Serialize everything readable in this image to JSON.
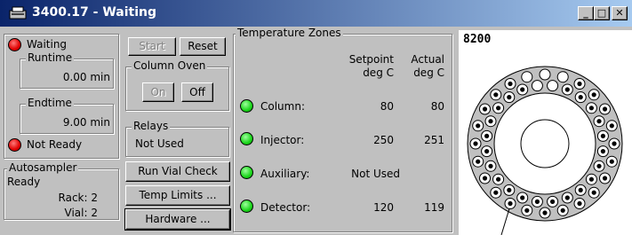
{
  "window": {
    "title": "3400.17 - Waiting",
    "buttons": [
      "_",
      "□",
      "✕"
    ]
  },
  "status": {
    "state": "Waiting",
    "runtime_label": "Runtime",
    "runtime": "0.00 min",
    "endtime_label": "Endtime",
    "endtime": "9.00 min",
    "ready": "Not Ready"
  },
  "autosampler": {
    "label": "Autosampler",
    "state": "Ready",
    "rack": "Rack: 2",
    "vial": "Vial: 2"
  },
  "controls": {
    "start": "Start",
    "reset": "Reset",
    "column_oven_label": "Column Oven",
    "on": "On",
    "off": "Off",
    "relays_label": "Relays",
    "relays_value": "Not Used",
    "run_vial_check": "Run Vial Check",
    "temp_limits": "Temp Limits ...",
    "hardware": "Hardware ..."
  },
  "zones": {
    "label": "Temperature Zones",
    "setpoint_header_1": "Setpoint",
    "setpoint_header_2": "deg C",
    "actual_header_1": "Actual",
    "actual_header_2": "deg C",
    "rows": [
      {
        "name": "Column:",
        "setpoint": "80",
        "actual": "80"
      },
      {
        "name": "Injector:",
        "setpoint": "250",
        "actual": "251"
      },
      {
        "name": "Auxiliary:",
        "setpoint": "Not Used",
        "actual": ""
      },
      {
        "name": "Detector:",
        "setpoint": "120",
        "actual": "119"
      }
    ]
  },
  "carousel": {
    "model": "8200",
    "filled_vials": [
      1,
      2,
      3,
      4,
      5,
      6,
      7,
      8,
      9,
      10,
      11,
      12,
      13,
      14,
      15,
      16,
      17,
      18,
      19,
      20,
      21,
      22,
      23,
      24,
      25,
      26,
      32,
      33,
      34,
      35,
      36,
      37,
      38,
      39,
      40,
      41,
      42,
      43,
      44,
      45,
      46,
      47,
      48
    ]
  },
  "colors": {
    "title_bar_start": "#0a246a",
    "title_bar_end": "#a6caf0",
    "led_red": "#e00000",
    "led_green": "#1ad51a"
  }
}
